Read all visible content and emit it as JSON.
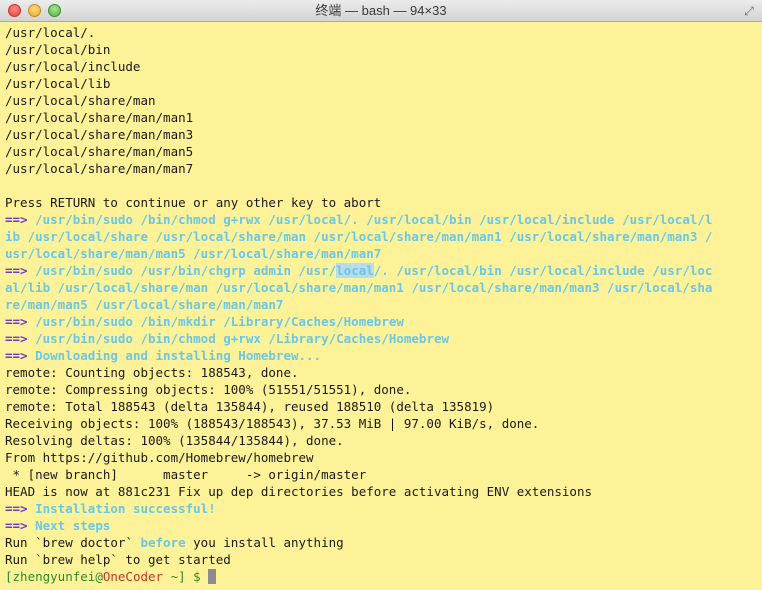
{
  "window": {
    "title": "终端 — bash — 94×33",
    "fullscreen_icon": "fullscreen-arrows-icon"
  },
  "colors": {
    "background": "#fdf297",
    "arrow": "#6a3cd6",
    "command": "#69c7e8",
    "selection": "#b9dcea"
  },
  "terminal": {
    "paths": [
      "/usr/local/.",
      "/usr/local/bin",
      "/usr/local/include",
      "/usr/local/lib",
      "/usr/local/share/man",
      "/usr/local/share/man/man1",
      "/usr/local/share/man/man3",
      "/usr/local/share/man/man5",
      "/usr/local/share/man/man7"
    ],
    "press_return": "Press RETURN to continue or any other key to abort",
    "arrow": "==>",
    "chmod_cmd": {
      "l1": "/usr/bin/sudo /bin/chmod g+rwx /usr/local/. /usr/local/bin /usr/local/include /usr/local/l",
      "l2": "ib /usr/local/share /usr/local/share/man /usr/local/share/man/man1 /usr/local/share/man/man3 /",
      "l3": "usr/local/share/man/man5 /usr/local/share/man/man7"
    },
    "chgrp_cmd": {
      "l1_pre": "/usr/bin/sudo /usr/bin/chgrp admin /usr/",
      "l1_hl": "local",
      "l1_post": "/. /usr/local/bin /usr/local/include /usr/loc",
      "l2": "al/lib /usr/local/share/man /usr/local/share/man/man1 /usr/local/share/man/man3 /usr/local/sha",
      "l3": "re/man/man5 /usr/local/share/man/man7"
    },
    "mkdir_cmd": "/usr/bin/sudo /bin/mkdir /Library/Caches/Homebrew",
    "chmod2_cmd": "/usr/bin/sudo /bin/chmod g+rwx /Library/Caches/Homebrew",
    "downloading": "Downloading and installing Homebrew...",
    "git_output": [
      "remote: Counting objects: 188543, done.",
      "remote: Compressing objects: 100% (51551/51551), done.",
      "remote: Total 188543 (delta 135844), reused 188510 (delta 135819)",
      "Receiving objects: 100% (188543/188543), 37.53 MiB | 97.00 KiB/s, done.",
      "Resolving deltas: 100% (135844/135844), done.",
      "From https://github.com/Homebrew/homebrew",
      " * [new branch]      master     -> origin/master",
      "HEAD is now at 881c231 Fix up dep directories before activating ENV extensions"
    ],
    "success": "Installation successful!",
    "next_steps": "Next steps",
    "run_doctor": {
      "pre": "Run `brew doctor` ",
      "kw": "before",
      "post": " you install anything"
    },
    "run_help": "Run `brew help` to get started",
    "prompt": {
      "open": "[",
      "user": "zhengyunfei",
      "at": "@",
      "host": "OneCoder",
      "rest": " ~] $ "
    }
  }
}
